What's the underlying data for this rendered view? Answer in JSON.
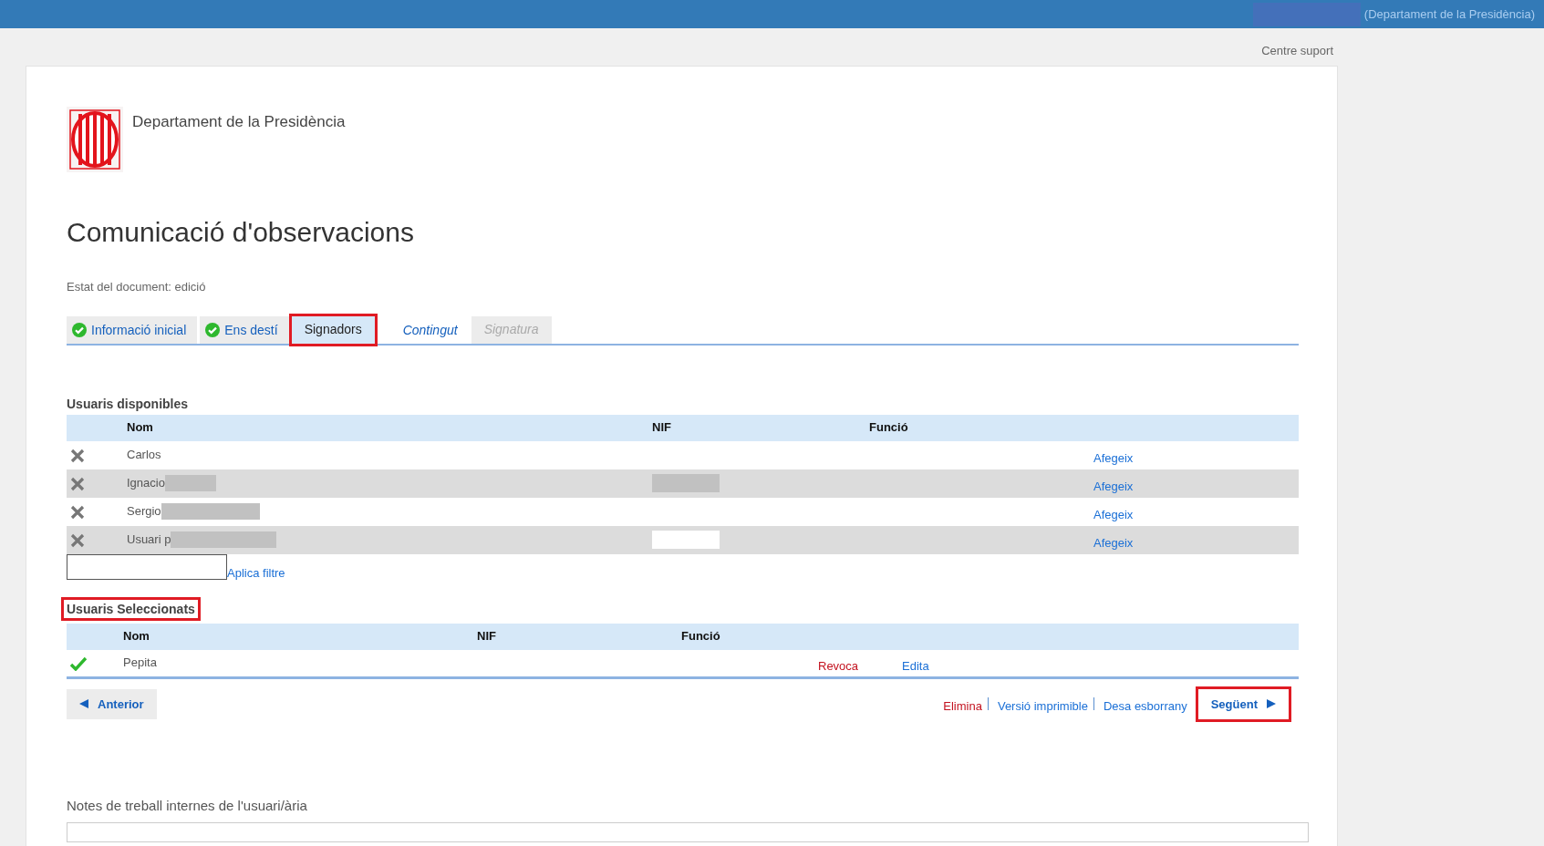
{
  "top_bar": {
    "user_redacted": true,
    "department": "(Departament de la Presidència)"
  },
  "support_link": "Centre suport",
  "header": {
    "department": "Departament de la Presidència"
  },
  "title": "Comunicació d'observacions",
  "status": "Estat del document: edició",
  "tabs": [
    {
      "label": "Informació inicial",
      "selected": false,
      "completed": true,
      "disabled": false,
      "highlighted": false
    },
    {
      "label": "Ens destí",
      "selected": false,
      "completed": true,
      "disabled": false,
      "highlighted": false
    },
    {
      "label": "Signadors",
      "selected": true,
      "completed": false,
      "disabled": false,
      "highlighted": true
    },
    {
      "label": "Contingut",
      "selected": false,
      "completed": false,
      "disabled": false,
      "highlighted": false
    },
    {
      "label": "Signatura",
      "selected": false,
      "completed": false,
      "disabled": true,
      "highlighted": false
    }
  ],
  "available_users": {
    "heading": "Usuaris disponibles",
    "columns": [
      "Nom",
      "NIF",
      "Funció"
    ],
    "rows": [
      {
        "name": "Carlos",
        "name_redacted": false,
        "action": "Afegeix"
      },
      {
        "name": "Ignacio",
        "name_redacted": true,
        "color": "#c1c1c1",
        "action": "Afegeix"
      },
      {
        "name": "Sergio",
        "name_redacted": true,
        "action": "Afegeix"
      },
      {
        "name": "Usuari p",
        "name_redacted": true,
        "color": "#ffffff",
        "action": "Afegeix"
      }
    ],
    "filter_action": "Aplica filtre"
  },
  "selected_users": {
    "heading": "Usuaris Seleccionats",
    "highlighted": true,
    "columns": [
      "Nom",
      "NIF",
      "Funció"
    ],
    "rows": [
      {
        "name": "Pepita",
        "actions": [
          {
            "label": "Revoca",
            "kind": "danger"
          },
          {
            "label": "Edita",
            "kind": "link"
          }
        ]
      }
    ]
  },
  "footer": {
    "previous": "Anterior",
    "links": [
      {
        "label": "Elimina",
        "kind": "danger"
      },
      {
        "label": "Versió imprimible",
        "kind": "link"
      },
      {
        "label": "Desa esborrany",
        "kind": "link"
      }
    ],
    "next": {
      "label": "Següent",
      "highlighted": true
    }
  },
  "notes": {
    "label": "Notes de treball internes de l'usuari/ària"
  }
}
